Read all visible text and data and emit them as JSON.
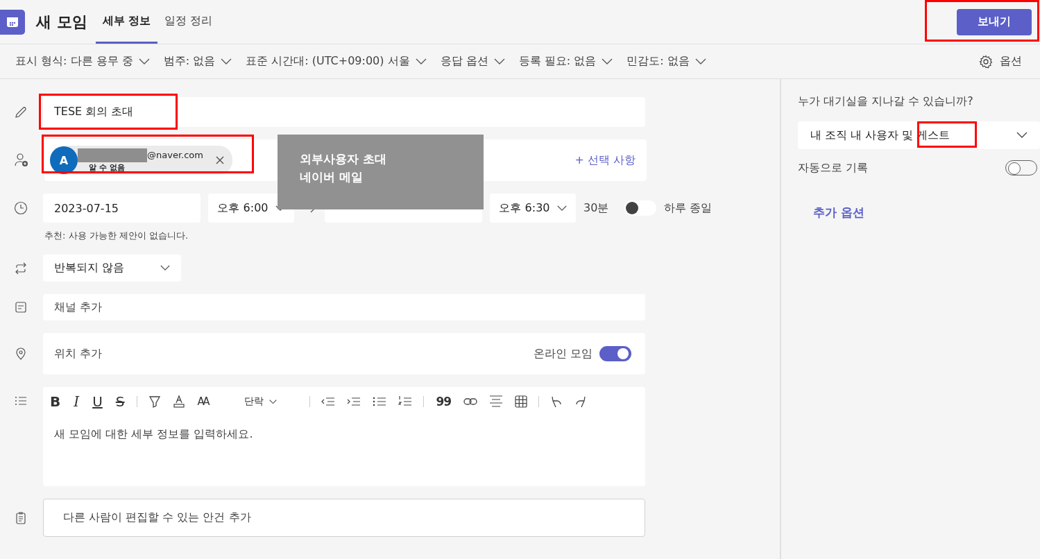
{
  "header": {
    "title": "새 모임",
    "tabs": [
      {
        "label": "세부 정보",
        "selected": true
      },
      {
        "label": "일정 정리",
        "selected": false
      }
    ],
    "send_button": "보내기"
  },
  "options_bar": {
    "items": [
      "표시 형식: 다른 용무 중",
      "범주: 없음",
      "표준 시간대: (UTC+09:00) 서울",
      "응답 옵션",
      "등록 필요: 없음",
      "민감도: 없음"
    ],
    "settings": "옵션"
  },
  "form": {
    "title": "TESE 회의 초대",
    "attendee": {
      "initial": "A",
      "email": "@naver.com",
      "status": "알 수 없음"
    },
    "optional_link": "+ 선택 사항",
    "start_date": "2023-07-15",
    "start_time": "오후 6:00",
    "end_time": "오후 6:30",
    "duration": "30분",
    "all_day": {
      "label": "하루 종일",
      "on": false
    },
    "suggestion": "추천: 사용 가능한 제안이 없습니다.",
    "repeat": "반복되지 않음",
    "channel_placeholder": "채널 추가",
    "location_placeholder": "위치 추가",
    "online": {
      "label": "온라인 모임",
      "on": true
    },
    "editor": {
      "format_glyphs": [
        {
          "glyph": "B",
          "kind": "bold"
        },
        {
          "glyph": "I",
          "kind": "italic"
        },
        {
          "glyph": "U",
          "kind": "underline"
        },
        {
          "glyph": "S",
          "kind": "strike"
        }
      ],
      "size_glyph": "AA",
      "paragraph": "단락",
      "quote_glyph": "99",
      "placeholder": "새 모임에 대한 세부 정보를 입력하세요."
    },
    "agenda_placeholder": "다른 사람이 편집할 수 있는 안건 추가"
  },
  "lobby": {
    "question": "누가 대기실을 지나갈 수 있습니까?",
    "choice": "내 조직 내 사용자 및 게스트",
    "record": {
      "label": "자동으로 기록",
      "on": false
    },
    "more_options": "추가 옵션"
  },
  "callout": {
    "lines": [
      "외부사용자 초대",
      "네이버 메일"
    ]
  }
}
